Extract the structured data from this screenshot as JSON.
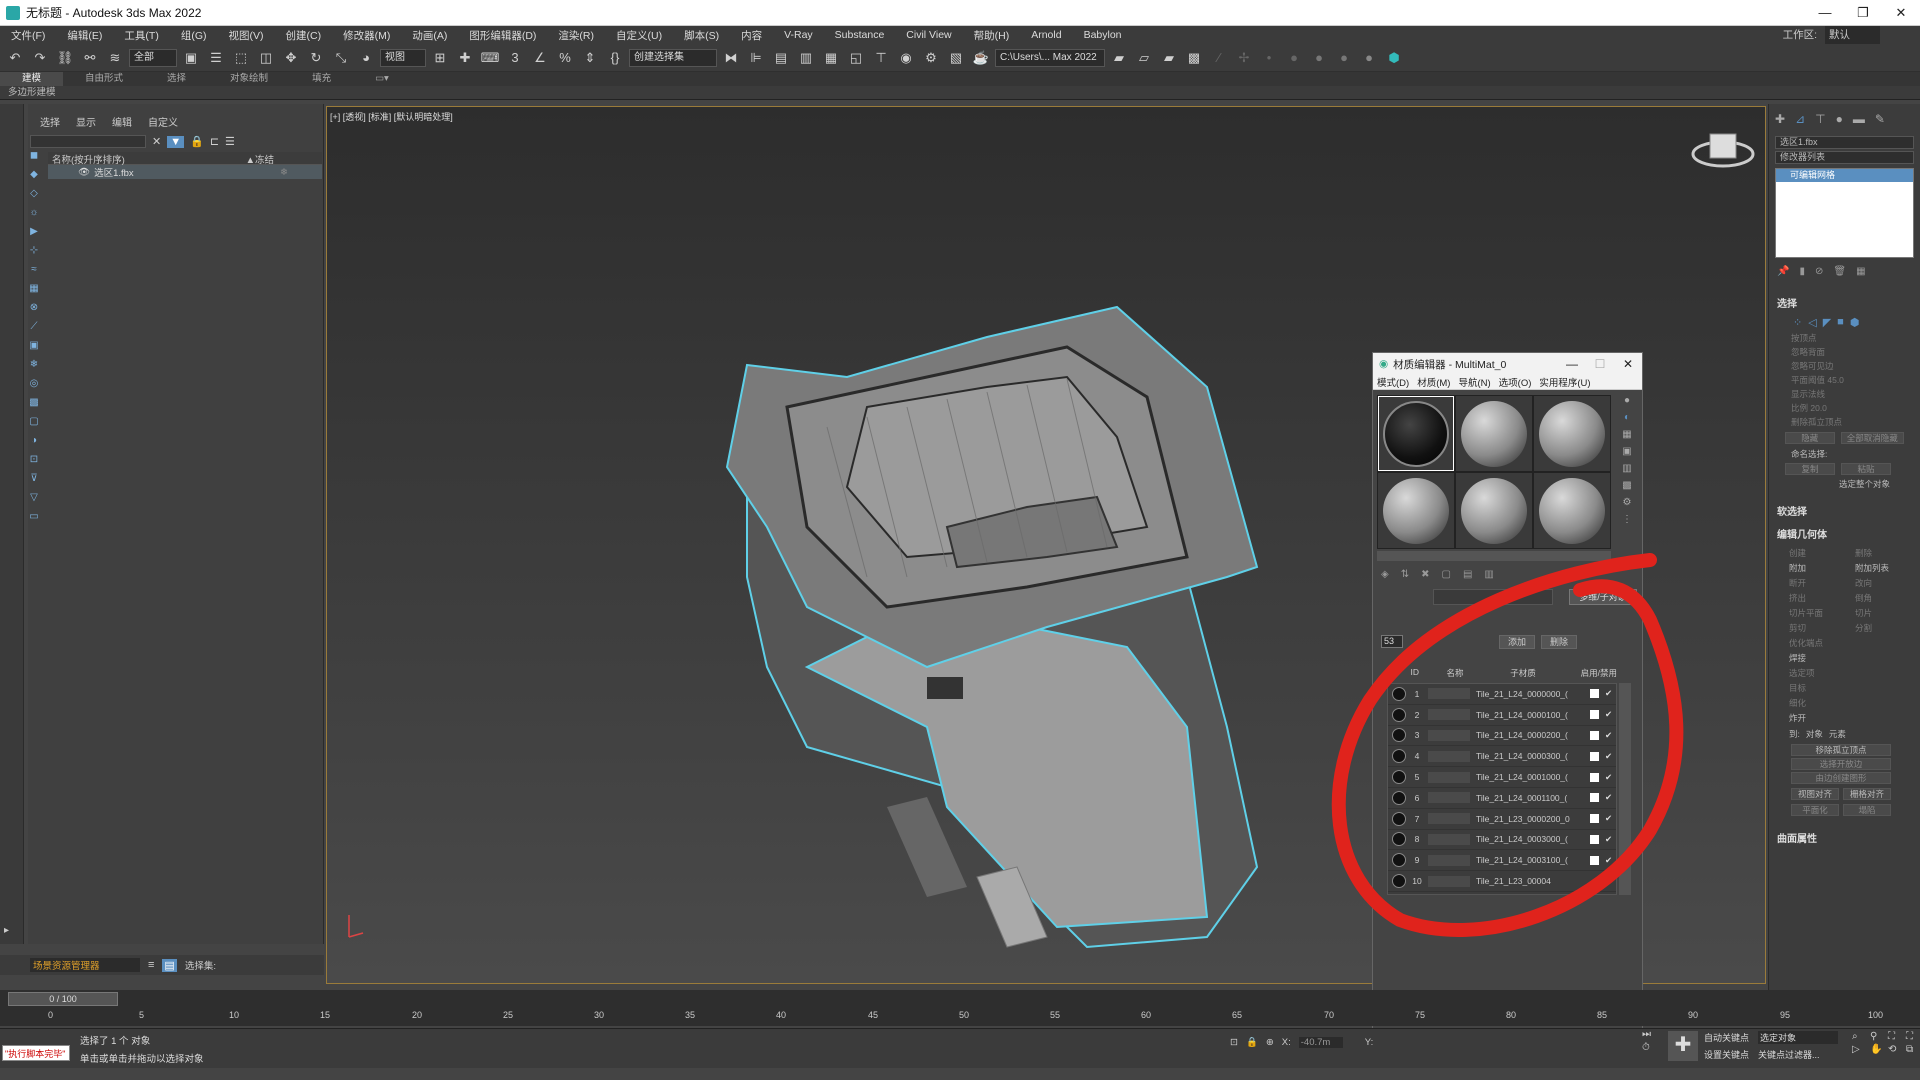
{
  "window": {
    "title": "无标题 - Autodesk 3ds Max 2022",
    "controls": [
      "—",
      "❐",
      "✕"
    ]
  },
  "menu": [
    "文件(F)",
    "编辑(E)",
    "工具(T)",
    "组(G)",
    "视图(V)",
    "创建(C)",
    "修改器(M)",
    "动画(A)",
    "图形编辑器(D)",
    "渲染(R)",
    "自定义(U)",
    "脚本(S)",
    "内容",
    "V-Ray",
    "Substance",
    "Civil View",
    "帮助(H)",
    "Arnold",
    "Babylon"
  ],
  "workspace": {
    "label": "工作区:",
    "value": "默认"
  },
  "toolbar": {
    "filter": "全部",
    "view": "视图",
    "selset": "创建选择集",
    "path": "C:\\Users\\... Max 2022"
  },
  "ribbon": {
    "tabs": [
      "建模",
      "自由形式",
      "选择",
      "对象绘制",
      "填充"
    ],
    "sub": "多边形建模"
  },
  "scene_explorer": {
    "tabs": [
      "选择",
      "显示",
      "编辑",
      "自定义"
    ],
    "col_name": "名称(按升序排序)",
    "col_frozen": "▲冻结",
    "item": "选区1.fbx",
    "manager": "场景资源管理器",
    "selset_label": "选择集:"
  },
  "viewport": {
    "label": "[+] [透视] [标准] [默认明暗处理]"
  },
  "command_panel": {
    "obj_name": "选区1.fbx",
    "mod_list": "修改器列表",
    "stack_item": "可编辑网格",
    "sel_title": "选择",
    "sel_opts": [
      "按顶点",
      "忽略背面",
      "忽略可见边",
      "平面阈值 45.0",
      "显示法线",
      "比例 20.0",
      "删除孤立顶点"
    ],
    "sel_btns": [
      "隐藏",
      "全部取消隐藏"
    ],
    "named_sel": "命名选择:",
    "named_btns": [
      "复制",
      "粘贴"
    ],
    "picked": "选定整个对象",
    "soft_sel": "软选择",
    "edit_geom": "编辑几何体",
    "geom_btns": [
      "创建",
      "删除",
      "附加",
      "附加列表",
      "断开",
      "改向",
      "挤出",
      "倒角",
      "切片平面",
      "切片",
      "剪切",
      "分割",
      "优化端点",
      "焊接",
      "选定项",
      "目标",
      "细化",
      "炸开",
      "移除孤立顶点",
      "选择开放边",
      "由边创建图形",
      "视图对齐",
      "栅格对齐",
      "平面化",
      "塌陷"
    ],
    "explode_to": "到:",
    "explode_opts": [
      "对象",
      "元素"
    ],
    "surface": "曲面属性"
  },
  "material_editor": {
    "title": "材质编辑器 - MultiMat_0",
    "menu": [
      "模式(D)",
      "材质(M)",
      "导航(N)",
      "选项(O)",
      "实用程序(U)"
    ],
    "type_btn": "多维/子对象",
    "count": "53",
    "add": "添加",
    "delete": "删除",
    "cols": [
      "ID",
      "名称",
      "子材质",
      "启用/禁用"
    ],
    "rows": [
      {
        "id": "1",
        "sub": "Tile_21_L24_0000000_(",
        "on": "✔"
      },
      {
        "id": "2",
        "sub": "Tile_21_L24_0000100_(",
        "on": "✔"
      },
      {
        "id": "3",
        "sub": "Tile_21_L24_0000200_(",
        "on": "✔"
      },
      {
        "id": "4",
        "sub": "Tile_21_L24_0000300_(",
        "on": "✔"
      },
      {
        "id": "5",
        "sub": "Tile_21_L24_0001000_(",
        "on": "✔"
      },
      {
        "id": "6",
        "sub": "Tile_21_L24_0001100_(",
        "on": "✔"
      },
      {
        "id": "7",
        "sub": "Tile_21_L23_0000200_0",
        "on": "✔"
      },
      {
        "id": "8",
        "sub": "Tile_21_L24_0003000_(",
        "on": "✔"
      },
      {
        "id": "9",
        "sub": "Tile_21_L24_0003100_(",
        "on": "✔"
      },
      {
        "id": "10",
        "sub": "Tile_21_L23_00004",
        "on": ""
      }
    ]
  },
  "timeline": {
    "frame": "0 / 100",
    "ticks": [
      "0",
      "5",
      "10",
      "15",
      "20",
      "25",
      "30",
      "35",
      "40",
      "45",
      "50",
      "55",
      "60",
      "65",
      "70",
      "75",
      "80",
      "85",
      "90",
      "95",
      "100"
    ]
  },
  "status": {
    "maxscript": "\"执行脚本完毕\"",
    "line1": "选择了 1 个 对象",
    "line2": "单击或单击并拖动以选择对象",
    "x_label": "X:",
    "x_value": "-40.7m",
    "y_label": "Y:",
    "autokey": "自动关键点",
    "setkey": "设置关键点",
    "sel_obj": "选定对象",
    "key_filter": "关键点过滤器..."
  },
  "colors": {
    "annotation": "#e0231c",
    "selection_outline": "#5fd0e8",
    "stack_select": "#5a8fc0"
  }
}
